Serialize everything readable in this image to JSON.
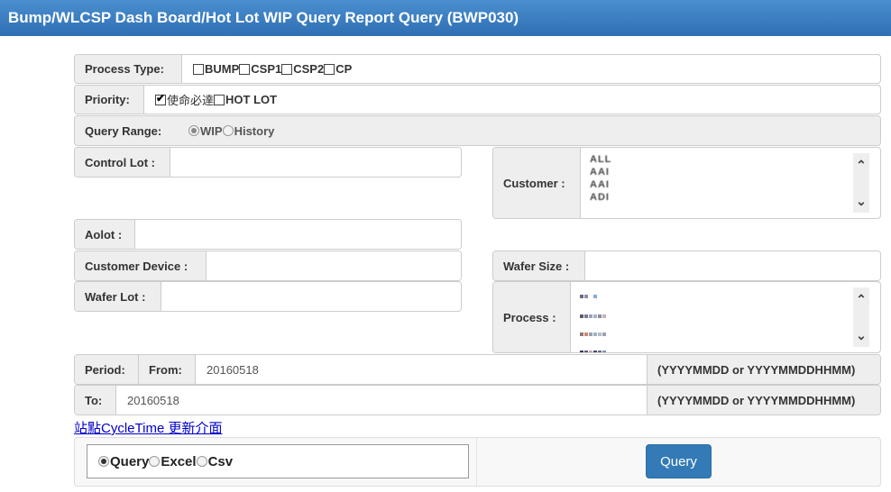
{
  "title": "Bump/WLCSP Dash Board/Hot Lot WIP Query Report Query (BWP030)",
  "process_type": {
    "label": "Process Type:",
    "options": [
      "BUMP",
      "CSP1",
      "CSP2",
      "CP"
    ]
  },
  "priority": {
    "label": "Priority:",
    "options": [
      "使命必達",
      "HOT LOT"
    ]
  },
  "query_range": {
    "label": "Query Range:",
    "options": [
      "WIP",
      "History"
    ]
  },
  "control_lot": {
    "label": "Control Lot :",
    "value": ""
  },
  "customer": {
    "label": "Customer :",
    "items": [
      "ALL",
      "AAI",
      "AAI",
      "ADI"
    ]
  },
  "aolot": {
    "label": "Aolot :",
    "value": ""
  },
  "customer_device": {
    "label": "Customer Device :",
    "value": ""
  },
  "wafer_size": {
    "label": "Wafer Size :",
    "value": ""
  },
  "wafer_lot": {
    "label": "Wafer Lot :",
    "value": ""
  },
  "process": {
    "label": "Process :"
  },
  "period": {
    "label": "Period:",
    "from_label": "From:",
    "from_value": "20160518",
    "to_label": "To:",
    "to_value": "20160518",
    "format_hint": "(YYYYMMDD or YYYYMMDDHHMM)"
  },
  "link_text": "站點CycleTime 更新介面",
  "output": {
    "options": [
      "Query",
      "Excel",
      "Csv"
    ]
  },
  "query_button": "Query",
  "colors": {
    "title_bar": "#3a7fc4",
    "button": "#337ab7"
  }
}
